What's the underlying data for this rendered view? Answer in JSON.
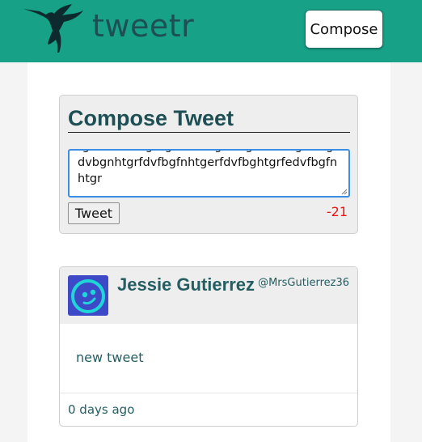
{
  "nav": {
    "logo_icon": "hummingbird-icon",
    "brand": "tweetr",
    "compose_label": "Compose",
    "background_color": "#17a187"
  },
  "compose": {
    "title": "Compose Tweet",
    "textarea_value": "tgrfedsvfbdgthgerfdvfbgfnhtgrfedvfbgfnhtgrfdvbgnhtgrfdvfbgfnhtgerfdvfbghtgrfedvfbgfnhtgr",
    "tweet_button_label": "Tweet",
    "char_counter": "-21",
    "counter_color": "#ee1111"
  },
  "tweets": [
    {
      "author_name": "Jessie Gutierrez",
      "handle": "@MrsGutierrez36",
      "avatar_icon": "smiley-avatar-icon",
      "text": "new tweet",
      "timestamp": "0 days ago"
    }
  ]
}
